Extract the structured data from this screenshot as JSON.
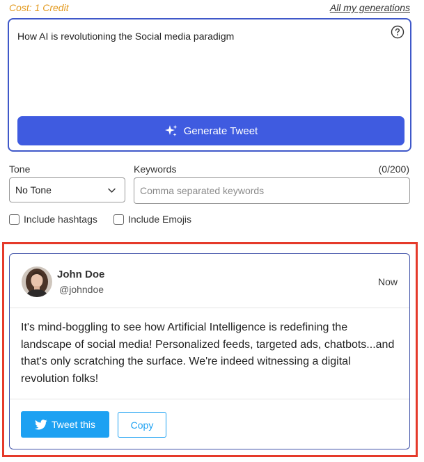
{
  "header": {
    "cost_label": "Cost: 1 Credit",
    "all_generations_link": "All my generations"
  },
  "prompt": {
    "text": "How AI is revolutioning the Social media paradigm",
    "help_icon": "question-circle-icon",
    "generate_button_label": "Generate Tweet",
    "generate_button_icon": "sparkle-icon"
  },
  "options": {
    "tone_label": "Tone",
    "tone_value": "No Tone",
    "keywords_label": "Keywords",
    "keywords_count": "(0/200)",
    "keywords_placeholder": "Comma separated keywords",
    "keywords_value": "",
    "include_hashtags_label": "Include hashtags",
    "include_hashtags_checked": false,
    "include_emojis_label": "Include Emojis",
    "include_emojis_checked": false
  },
  "tweet": {
    "user_name": "John Doe",
    "user_handle": "@johndoe",
    "time": "Now",
    "text": "It's mind-boggling to see how Artificial Intelligence is redefining the landscape of social media! Personalized feeds, targeted ads, chatbots...and that's only scratching the surface. We're indeed witnessing a digital revolution folks!",
    "tweet_button_label": "Tweet this",
    "tweet_button_icon": "twitter-bird-icon",
    "copy_button_label": "Copy"
  },
  "colors": {
    "accent": "#3f5be0",
    "cost": "#e39a1f",
    "twitter": "#1da1f2",
    "highlight": "#e53a2a"
  }
}
